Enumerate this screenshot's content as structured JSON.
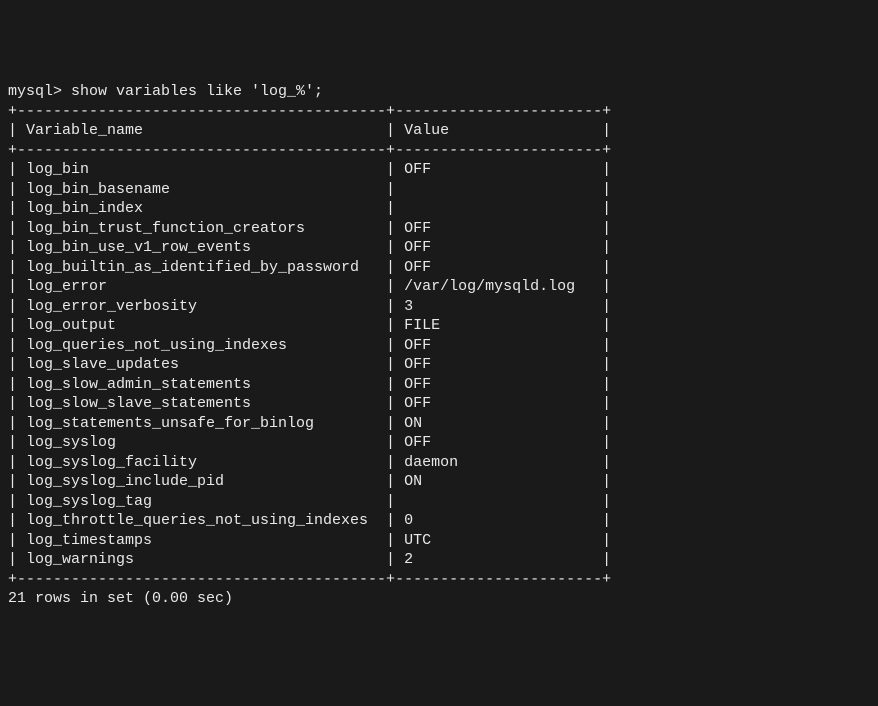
{
  "prompt": "mysql> ",
  "command": "show variables like 'log_%';",
  "table": {
    "columns": [
      "Variable_name",
      "Value"
    ],
    "rows": [
      {
        "name": "log_bin",
        "value": "OFF"
      },
      {
        "name": "log_bin_basename",
        "value": ""
      },
      {
        "name": "log_bin_index",
        "value": ""
      },
      {
        "name": "log_bin_trust_function_creators",
        "value": "OFF"
      },
      {
        "name": "log_bin_use_v1_row_events",
        "value": "OFF"
      },
      {
        "name": "log_builtin_as_identified_by_password",
        "value": "OFF"
      },
      {
        "name": "log_error",
        "value": "/var/log/mysqld.log"
      },
      {
        "name": "log_error_verbosity",
        "value": "3"
      },
      {
        "name": "log_output",
        "value": "FILE"
      },
      {
        "name": "log_queries_not_using_indexes",
        "value": "OFF"
      },
      {
        "name": "log_slave_updates",
        "value": "OFF"
      },
      {
        "name": "log_slow_admin_statements",
        "value": "OFF"
      },
      {
        "name": "log_slow_slave_statements",
        "value": "OFF"
      },
      {
        "name": "log_statements_unsafe_for_binlog",
        "value": "ON"
      },
      {
        "name": "log_syslog",
        "value": "OFF"
      },
      {
        "name": "log_syslog_facility",
        "value": "daemon"
      },
      {
        "name": "log_syslog_include_pid",
        "value": "ON"
      },
      {
        "name": "log_syslog_tag",
        "value": ""
      },
      {
        "name": "log_throttle_queries_not_using_indexes",
        "value": "0"
      },
      {
        "name": "log_timestamps",
        "value": "UTC"
      },
      {
        "name": "log_warnings",
        "value": "2"
      }
    ]
  },
  "footer": "21 rows in set (0.00 sec)",
  "col1_width": 40,
  "col2_width": 22
}
